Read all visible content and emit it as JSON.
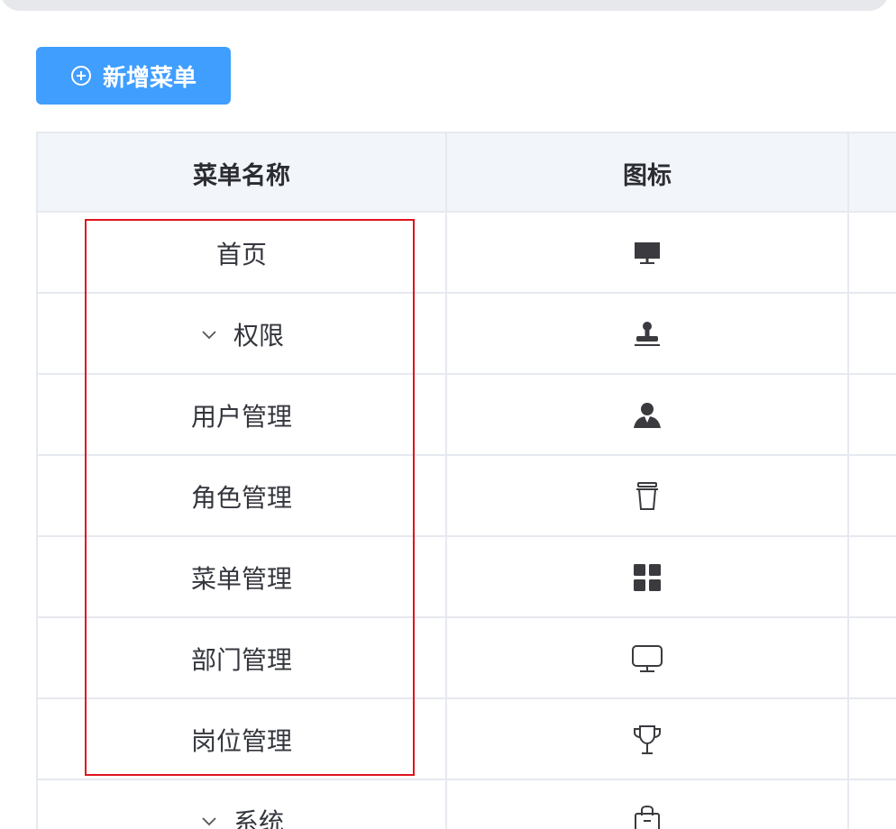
{
  "toolbar": {
    "add_label": "新增菜单",
    "add_icon": "plus-circle-icon",
    "button_color": "#409eff"
  },
  "table": {
    "columns": [
      "菜单名称",
      "图标"
    ],
    "rows": [
      {
        "name": "首页",
        "expandable": false,
        "icon": "monitor-filled-icon"
      },
      {
        "name": "权限",
        "expandable": true,
        "expanded": true,
        "icon": "stamp-icon"
      },
      {
        "name": "用户管理",
        "expandable": false,
        "icon": "user-filled-icon"
      },
      {
        "name": "角色管理",
        "expandable": false,
        "icon": "cup-icon"
      },
      {
        "name": "菜单管理",
        "expandable": false,
        "icon": "grid-icon"
      },
      {
        "name": "部门管理",
        "expandable": false,
        "icon": "monitor-outline-icon"
      },
      {
        "name": "岗位管理",
        "expandable": false,
        "icon": "trophy-icon"
      },
      {
        "name": "系统",
        "expandable": true,
        "expanded": true,
        "icon": "shopping-bag-icon"
      }
    ]
  },
  "annotation": {
    "highlight_color": "#e0141f"
  }
}
